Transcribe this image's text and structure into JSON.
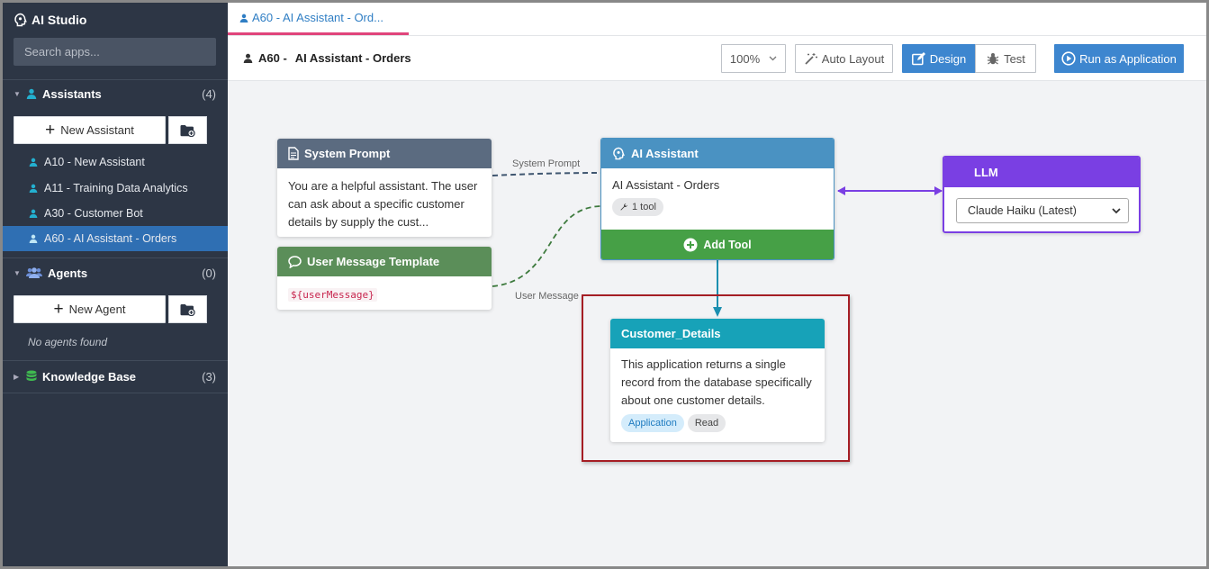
{
  "sidebar": {
    "brand": "AI Studio",
    "search_placeholder": "Search apps...",
    "assistants": {
      "label": "Assistants",
      "count": "(4)",
      "new_button": "New Assistant",
      "items": [
        {
          "label": "A10 - New Assistant"
        },
        {
          "label": "A11 - Training Data Analytics"
        },
        {
          "label": "A30 - Customer Bot"
        },
        {
          "label": "A60 - AI Assistant - Orders"
        }
      ]
    },
    "agents": {
      "label": "Agents",
      "count": "(0)",
      "new_button": "New Agent",
      "empty_text": "No agents found"
    },
    "knowledge_base": {
      "label": "Knowledge Base",
      "count": "(3)"
    }
  },
  "tab": {
    "label": "A60 - AI Assistant - Ord..."
  },
  "toolbar": {
    "title_prefix": "A60 -",
    "title_name": "AI Assistant - Orders",
    "zoom": "100%",
    "auto_layout": "Auto Layout",
    "design": "Design",
    "test": "Test",
    "run": "Run as Application"
  },
  "canvas": {
    "system_prompt": {
      "title": "System Prompt",
      "text": "You are a helpful assistant. The user can ask about a specific customer details by supply the cust..."
    },
    "user_message": {
      "title": "User Message Template",
      "code": "${userMessage}"
    },
    "assistant": {
      "title": "AI Assistant",
      "name": "AI Assistant - Orders",
      "tools": "1 tool",
      "add_tool": "Add Tool"
    },
    "llm": {
      "title": "LLM",
      "model": "Claude Haiku (Latest)"
    },
    "tool": {
      "title": "Customer_Details",
      "description": "This application returns a single record from the database specifically about one customer details.",
      "tags": [
        "Application",
        "Read"
      ]
    },
    "link_labels": {
      "system": "System Prompt",
      "user": "User Message"
    }
  },
  "colors": {
    "sidebar_bg": "#2d3645",
    "active_item": "#2f6fb3",
    "accent_blue": "#3d86cf",
    "tab_underline": "#e0457b",
    "system_head": "#5b6b80",
    "user_head": "#5b8e59",
    "assistant_head": "#4a92c2",
    "llm_head": "#7a3fe3",
    "tool_head": "#17a2b8",
    "add_tool": "#46a046",
    "highlight": "#a51d24"
  }
}
